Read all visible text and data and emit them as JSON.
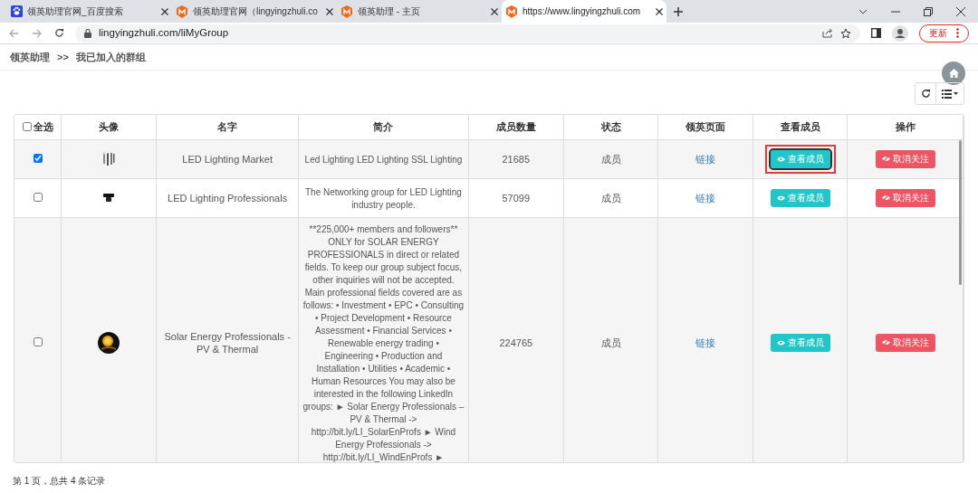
{
  "browser": {
    "tabs": [
      {
        "title": "领英助理官网_百度搜索",
        "kind": "search",
        "selected": false
      },
      {
        "title": "领英助理官网（lingyingzhuli.co",
        "kind": "site",
        "selected": false
      },
      {
        "title": "领英助理 - 主页",
        "kind": "site",
        "selected": false
      },
      {
        "title": "https://www.lingyingzhuli.com",
        "kind": "site",
        "selected": true
      }
    ],
    "address": "lingyingzhuli.com/liMyGroup",
    "update_button": "更新"
  },
  "breadcrumb": [
    "领英助理",
    ">>",
    "我已加入的群组"
  ],
  "table": {
    "select_all": {
      "label": "全选",
      "checked": false
    },
    "columns": [
      "头像",
      "名字",
      "简介",
      "成员数量",
      "状态",
      "领英页面",
      "查看成员",
      "操作"
    ],
    "rows": [
      {
        "checked": true,
        "name": "LED Lighting Market",
        "intro": "Led Lighting LED Lighting SSL Lighting",
        "members": "21685",
        "status": "成员",
        "link": "链接",
        "view_button": "查看成员",
        "view_highlighted": true,
        "action_button": "取消关注"
      },
      {
        "checked": false,
        "name": "LED Lighting Professionals",
        "intro": "The Networking group for LED Lighting industry people.",
        "members": "57099",
        "status": "成员",
        "link": "链接",
        "view_button": "查看成员",
        "view_highlighted": false,
        "action_button": "取消关注"
      },
      {
        "checked": false,
        "name": "Solar Energy Professionals - PV & Thermal",
        "intro": "**225,000+ members and followers** ONLY for SOLAR ENERGY PROFESSIONALS in direct or related fields. To keep our group subject focus, other inquiries will not be accepted. Main professional fields covered are as follows: • Investment • EPC • Consulting • Project Development • Resource Assessment • Financial Services • Renewable energy trading • Engineering • Production and Installation • Utilities • Academic • Human Resources You may also be interested in the following LinkedIn groups: ► Solar Energy Professionals – PV & Thermal -> http://bit.ly/LI_SolarEnProfs ► Wind Energy Professionals -> http://bit.ly/LI_WindEnProfs ►",
        "members": "224765",
        "status": "成员",
        "link": "链接",
        "view_button": "查看成员",
        "view_highlighted": false,
        "action_button": "取消关注"
      }
    ]
  },
  "pagination": "第 1 页，总共 4 条记录"
}
